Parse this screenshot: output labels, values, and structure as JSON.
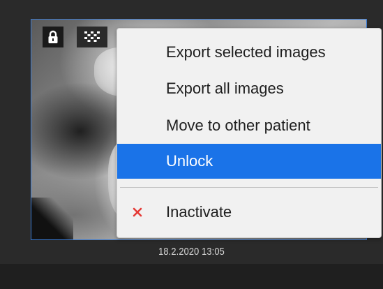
{
  "thumbnail": {
    "timestamp": "18.2.2020 13:05",
    "lock_icon": "lock-icon",
    "grid_icon": "grid-icon"
  },
  "context_menu": {
    "items": [
      {
        "label": "Export selected images",
        "highlighted": false
      },
      {
        "label": "Export all images",
        "highlighted": false
      },
      {
        "label": "Move to other patient",
        "highlighted": false
      },
      {
        "label": "Unlock",
        "highlighted": true
      },
      {
        "label": "Inactivate",
        "highlighted": false,
        "icon": "close-icon",
        "icon_color": "#e53935"
      }
    ]
  },
  "colors": {
    "highlight": "#1a73e8",
    "selection_border": "#3a7bd5",
    "menu_background": "#f1f1f1"
  }
}
